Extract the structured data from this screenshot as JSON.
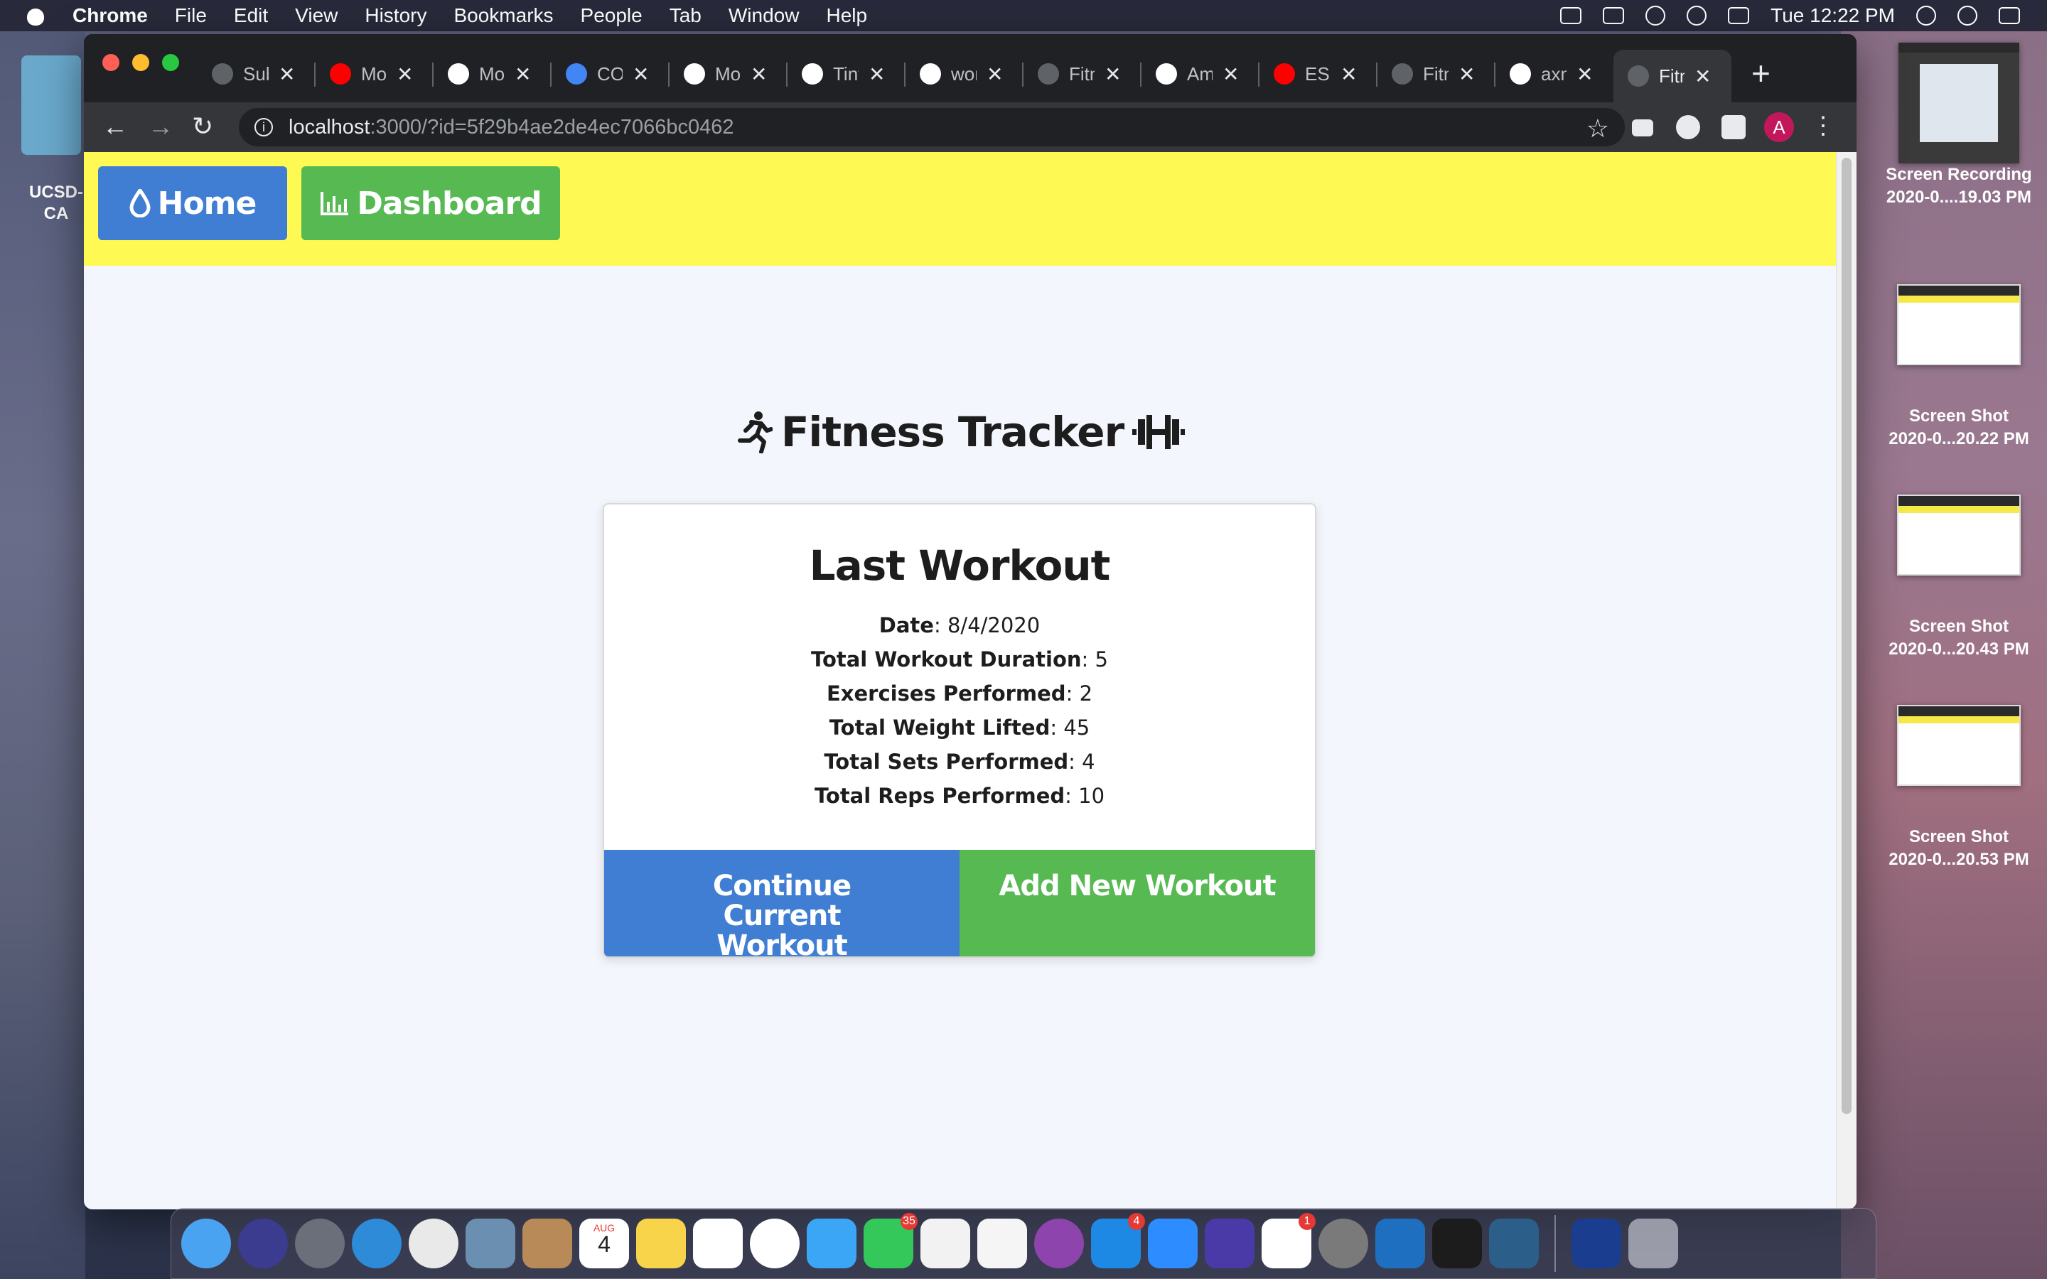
{
  "menubar": {
    "app": "Chrome",
    "items": [
      "File",
      "Edit",
      "View",
      "History",
      "Bookmarks",
      "People",
      "Tab",
      "Window",
      "Help"
    ],
    "clock": "Tue 12:22 PM"
  },
  "browser": {
    "tabs": [
      {
        "title": "Sub",
        "icon": "globe-icon",
        "color": "#5f6368"
      },
      {
        "title": "Mor",
        "icon": "youtube-icon",
        "color": "#ff0000"
      },
      {
        "title": "Mor",
        "icon": "github-icon",
        "color": "#ffffff"
      },
      {
        "title": "CO",
        "icon": "docs-icon",
        "color": "#4285f4"
      },
      {
        "title": "Mo",
        "icon": "site-icon",
        "color": "#ffffff"
      },
      {
        "title": "Tiny",
        "icon": "tinypng-icon",
        "color": "#ffffff"
      },
      {
        "title": "wor",
        "icon": "github-icon",
        "color": "#ffffff"
      },
      {
        "title": "Fitn",
        "icon": "globe-icon",
        "color": "#5f6368"
      },
      {
        "title": "Am",
        "icon": "amazon-icon",
        "color": "#ffffff"
      },
      {
        "title": "ESL",
        "icon": "youtube-icon",
        "color": "#ff0000"
      },
      {
        "title": "Fitn",
        "icon": "globe-icon",
        "color": "#5f6368"
      },
      {
        "title": "axn",
        "icon": "github-icon",
        "color": "#ffffff"
      },
      {
        "title": "Fitn",
        "icon": "globe-icon",
        "color": "#5f6368"
      }
    ],
    "active_tab_index": 12,
    "url_host": "localhost",
    "url_path": ":3000/?id=5f29b4ae2de4ec7066bc0462",
    "profile_initial": "A"
  },
  "site": {
    "nav": {
      "home_label": "Home",
      "dashboard_label": "Dashboard"
    },
    "title": "Fitness Tracker",
    "card": {
      "title": "Last Workout",
      "stats": [
        {
          "label": "Date",
          "value": "8/4/2020"
        },
        {
          "label": "Total Workout Duration",
          "value": "5"
        },
        {
          "label": "Exercises Performed",
          "value": "2"
        },
        {
          "label": "Total Weight Lifted",
          "value": "45"
        },
        {
          "label": "Total Sets Performed",
          "value": "4"
        },
        {
          "label": "Total Reps Performed",
          "value": "10"
        }
      ],
      "continue_label": "Continue Current Workout",
      "add_label": "Add New Workout"
    },
    "colors": {
      "nav_bg": "#fff953",
      "blue": "#3f7ed3",
      "green": "#56b952"
    }
  },
  "desktop": {
    "folder_label": "UCSD-\nCA",
    "thumbnails": [
      {
        "name": "Screen Recording",
        "date": "2020-0....19.03 PM"
      },
      {
        "name": "Screen Shot",
        "date": "2020-0...20.22 PM"
      },
      {
        "name": "Screen Shot",
        "date": "2020-0...20.43 PM"
      },
      {
        "name": "Screen Shot",
        "date": "2020-0...20.53 PM"
      }
    ]
  },
  "dock": {
    "apps": [
      "finder",
      "siri",
      "launchpad",
      "safari",
      "chrome",
      "preview",
      "contacts",
      "calendar",
      "notes",
      "reminders",
      "photos",
      "messages",
      "facetime",
      "news",
      "music",
      "podcasts",
      "app-store",
      "zoom",
      "imovie",
      "slack",
      "system-preferences",
      "vscode",
      "terminal",
      "mysql-workbench",
      "wd-backup"
    ],
    "calendar_month": "AUG",
    "calendar_day": "4",
    "badges": {
      "facetime": "35",
      "app-store": "4",
      "slack": "1"
    }
  }
}
